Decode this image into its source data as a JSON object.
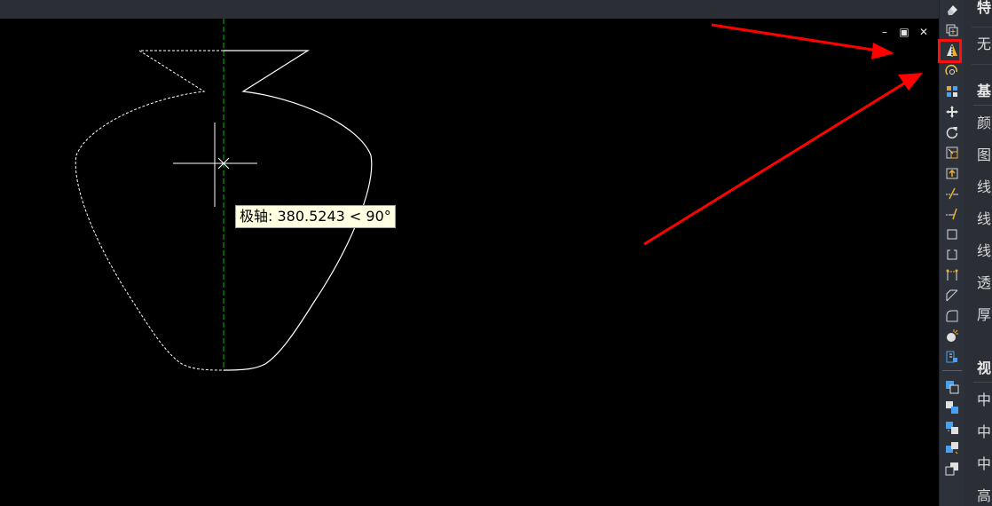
{
  "canvas": {
    "tooltip": "极轴: 380.5243 < 90°",
    "window_controls": {
      "minimize": "–",
      "restore": "▣",
      "close": "✕"
    }
  },
  "toolbar": {
    "tools": [
      {
        "name": "erase-icon"
      },
      {
        "name": "copy-icon"
      },
      {
        "name": "mirror-icon",
        "highlighted": true
      },
      {
        "name": "offset-icon"
      },
      {
        "name": "array-icon"
      },
      {
        "name": "move-icon"
      },
      {
        "name": "rotate-icon"
      },
      {
        "name": "scale-icon"
      },
      {
        "name": "stretch-icon"
      },
      {
        "name": "trim-icon"
      },
      {
        "name": "extend-icon"
      },
      {
        "name": "break-at-point-icon"
      },
      {
        "name": "break-icon"
      },
      {
        "name": "join-icon"
      },
      {
        "name": "chamfer-icon"
      },
      {
        "name": "fillet-icon"
      },
      {
        "name": "explode-icon"
      },
      {
        "name": "edit-block-icon"
      },
      {
        "name": "draw-order-front-icon"
      },
      {
        "name": "draw-order-back-icon"
      },
      {
        "name": "bring-above-icon"
      },
      {
        "name": "send-under-icon"
      },
      {
        "name": "bring-text-front-icon"
      }
    ],
    "highlight_color": "#ff1010"
  },
  "properties": {
    "header_top": "特",
    "row_none": "无",
    "section_basic": "基",
    "rows_basic": [
      "颜",
      "图",
      "线",
      "线",
      "线",
      "透",
      "厚"
    ],
    "section_view": "视",
    "rows_view": [
      "中",
      "中",
      "中",
      "高"
    ]
  },
  "colors": {
    "canvas_bg": "#000000",
    "panel_bg": "#2b2e35",
    "drawing": "#ffffff",
    "axis": "#00c000",
    "arrow": "#ff0000",
    "tooltip_bg": "#ffffe1"
  }
}
